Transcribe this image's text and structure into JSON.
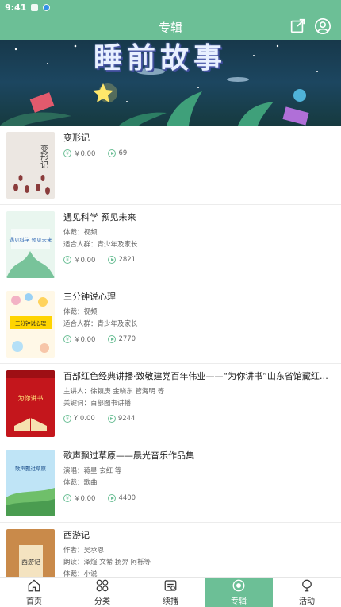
{
  "status": {
    "time": "9:41"
  },
  "header": {
    "title": "专辑",
    "share_icon": "share-icon",
    "profile_icon": "user-icon"
  },
  "banner": {
    "title": "睡前故事"
  },
  "albums": [
    {
      "title": "变形记",
      "price": "￥0.00",
      "plays": "69",
      "cover_text": "变形记"
    },
    {
      "title": "遇见科学 预见未来",
      "type_label": "体裁：视频",
      "audience": "适合人群：青少年及家长",
      "price": "￥0.00",
      "plays": "2821",
      "cover_text": "遇见科学 预见未来"
    },
    {
      "title": "三分钟说心理",
      "type_label": "体裁：视频",
      "audience": "适合人群：青少年及家长",
      "price": "￥0.00",
      "plays": "2770",
      "cover_text": "三分钟说心理"
    },
    {
      "title": "百部红色经典讲播·致敬建党百年伟业——“为你讲书”山东省馆藏红色经典…",
      "speaker": "主讲人：徐镇庚 金晓东 管海明 等",
      "keywords": "关键词：百部图书讲播",
      "price": "Y 0.00",
      "plays": "9244",
      "cover_text": "为你讲书"
    },
    {
      "title": "歌声飘过草原——晨光音乐作品集",
      "singer": "演唱：蒋星 玄红 等",
      "type_label": "体裁：歌曲",
      "price": "￥0.00",
      "plays": "4400",
      "cover_text": "歌声飘过草原"
    },
    {
      "title": "西游记",
      "author": "作者：吴承恩",
      "reader": "朗读：泽煊 文希 扬羿 阿栎等",
      "type_label": "体裁：小说",
      "cover_text": "西游记"
    }
  ],
  "tabs": [
    {
      "label": "首页",
      "icon": "home-icon"
    },
    {
      "label": "分类",
      "icon": "category-icon"
    },
    {
      "label": "续播",
      "icon": "continue-icon"
    },
    {
      "label": "专辑",
      "icon": "album-icon",
      "active": true
    },
    {
      "label": "活动",
      "icon": "activity-icon"
    }
  ],
  "colors": {
    "primary": "#6cbf96",
    "text": "#333333"
  }
}
